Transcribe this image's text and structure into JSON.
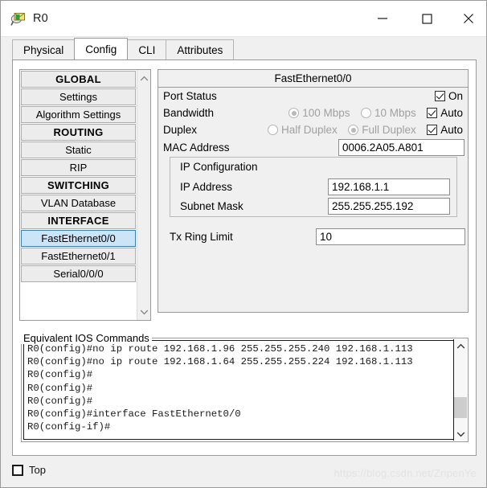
{
  "window": {
    "title": "R0",
    "icon": "router-device-icon",
    "controls": {
      "minimize": "minimize-icon",
      "maximize": "maximize-icon",
      "close": "close-icon"
    }
  },
  "tabs": [
    {
      "label": "Physical",
      "active": false
    },
    {
      "label": "Config",
      "active": true
    },
    {
      "label": "CLI",
      "active": false
    },
    {
      "label": "Attributes",
      "active": false
    }
  ],
  "sidebar": {
    "items": [
      {
        "label": "GLOBAL",
        "type": "header",
        "selected": false
      },
      {
        "label": "Settings",
        "type": "item",
        "selected": false
      },
      {
        "label": "Algorithm Settings",
        "type": "item",
        "selected": false
      },
      {
        "label": "ROUTING",
        "type": "header",
        "selected": false
      },
      {
        "label": "Static",
        "type": "item",
        "selected": false
      },
      {
        "label": "RIP",
        "type": "item",
        "selected": false
      },
      {
        "label": "SWITCHING",
        "type": "header",
        "selected": false
      },
      {
        "label": "VLAN Database",
        "type": "item",
        "selected": false
      },
      {
        "label": "INTERFACE",
        "type": "header",
        "selected": false
      },
      {
        "label": "FastEthernet0/0",
        "type": "item",
        "selected": true
      },
      {
        "label": "FastEthernet0/1",
        "type": "item",
        "selected": false
      },
      {
        "label": "Serial0/0/0",
        "type": "item",
        "selected": false
      }
    ],
    "scroll_up": "chevron-up-icon",
    "scroll_down": "chevron-down-icon"
  },
  "config": {
    "panel_title": "FastEthernet0/0",
    "port_status": {
      "label": "Port Status",
      "on_label": "On",
      "on_checked": true
    },
    "bandwidth": {
      "label": "Bandwidth",
      "option_100": "100 Mbps",
      "option_10": "10 Mbps",
      "selected": "100 Mbps",
      "auto_label": "Auto",
      "auto_checked": true
    },
    "duplex": {
      "label": "Duplex",
      "option_half": "Half Duplex",
      "option_full": "Full Duplex",
      "selected": "Full Duplex",
      "auto_label": "Auto",
      "auto_checked": true
    },
    "mac": {
      "label": "MAC Address",
      "value": "0006.2A05.A801"
    },
    "ip_configuration": {
      "group_label": "IP Configuration",
      "ip_address": {
        "label": "IP Address",
        "value": "192.168.1.1"
      },
      "subnet_mask": {
        "label": "Subnet Mask",
        "value": "255.255.255.192"
      }
    },
    "tx_ring_limit": {
      "label": "Tx Ring Limit",
      "value": "10"
    }
  },
  "ios": {
    "legend": "Equivalent IOS Commands",
    "lines": [
      "R0(config)#no ip route 192.168.1.96 255.255.255.240 192.168.1.113",
      "R0(config)#no ip route 192.168.1.64 255.255.255.224 192.168.1.113",
      "R0(config)#",
      "R0(config)#",
      "R0(config)#",
      "R0(config)#interface FastEthernet0/0",
      "R0(config-if)#"
    ],
    "scroll_up": "chevron-up-icon",
    "scroll_down": "chevron-down-icon"
  },
  "footer": {
    "top_checkbox_label": "Top",
    "top_checked": false,
    "watermark": "https://blog.csdn.net/ZripenYe"
  },
  "colors": {
    "selection_blue": "#cce4f7",
    "selection_border": "#3c7fb1",
    "panel_gray": "#f0f0f0",
    "button_gray": "#ececec"
  }
}
